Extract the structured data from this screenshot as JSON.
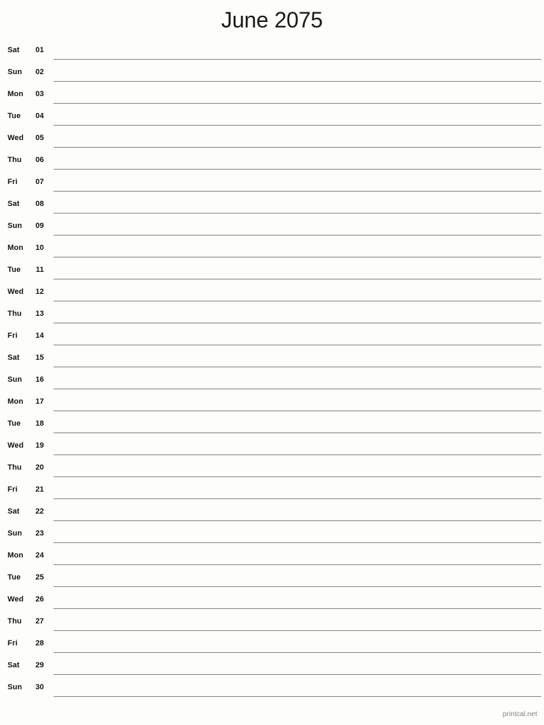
{
  "header": {
    "title": "June 2075",
    "month_name": "June",
    "year": "2075"
  },
  "calendar": {
    "days_in_month": 30,
    "first_weekday": "Sat",
    "line_color": "#808080",
    "text_color": "#111111",
    "background_color": "#fdfdfa",
    "rows": [
      {
        "weekday": "Sat",
        "daynum": "01",
        "note": ""
      },
      {
        "weekday": "Sun",
        "daynum": "02",
        "note": ""
      },
      {
        "weekday": "Mon",
        "daynum": "03",
        "note": ""
      },
      {
        "weekday": "Tue",
        "daynum": "04",
        "note": ""
      },
      {
        "weekday": "Wed",
        "daynum": "05",
        "note": ""
      },
      {
        "weekday": "Thu",
        "daynum": "06",
        "note": ""
      },
      {
        "weekday": "Fri",
        "daynum": "07",
        "note": ""
      },
      {
        "weekday": "Sat",
        "daynum": "08",
        "note": ""
      },
      {
        "weekday": "Sun",
        "daynum": "09",
        "note": ""
      },
      {
        "weekday": "Mon",
        "daynum": "10",
        "note": ""
      },
      {
        "weekday": "Tue",
        "daynum": "11",
        "note": ""
      },
      {
        "weekday": "Wed",
        "daynum": "12",
        "note": ""
      },
      {
        "weekday": "Thu",
        "daynum": "13",
        "note": ""
      },
      {
        "weekday": "Fri",
        "daynum": "14",
        "note": ""
      },
      {
        "weekday": "Sat",
        "daynum": "15",
        "note": ""
      },
      {
        "weekday": "Sun",
        "daynum": "16",
        "note": ""
      },
      {
        "weekday": "Mon",
        "daynum": "17",
        "note": ""
      },
      {
        "weekday": "Tue",
        "daynum": "18",
        "note": ""
      },
      {
        "weekday": "Wed",
        "daynum": "19",
        "note": ""
      },
      {
        "weekday": "Thu",
        "daynum": "20",
        "note": ""
      },
      {
        "weekday": "Fri",
        "daynum": "21",
        "note": ""
      },
      {
        "weekday": "Sat",
        "daynum": "22",
        "note": ""
      },
      {
        "weekday": "Sun",
        "daynum": "23",
        "note": ""
      },
      {
        "weekday": "Mon",
        "daynum": "24",
        "note": ""
      },
      {
        "weekday": "Tue",
        "daynum": "25",
        "note": ""
      },
      {
        "weekday": "Wed",
        "daynum": "26",
        "note": ""
      },
      {
        "weekday": "Thu",
        "daynum": "27",
        "note": ""
      },
      {
        "weekday": "Fri",
        "daynum": "28",
        "note": ""
      },
      {
        "weekday": "Sat",
        "daynum": "29",
        "note": ""
      },
      {
        "weekday": "Sun",
        "daynum": "30",
        "note": ""
      }
    ]
  },
  "footer": {
    "credit": "printcal.net"
  }
}
